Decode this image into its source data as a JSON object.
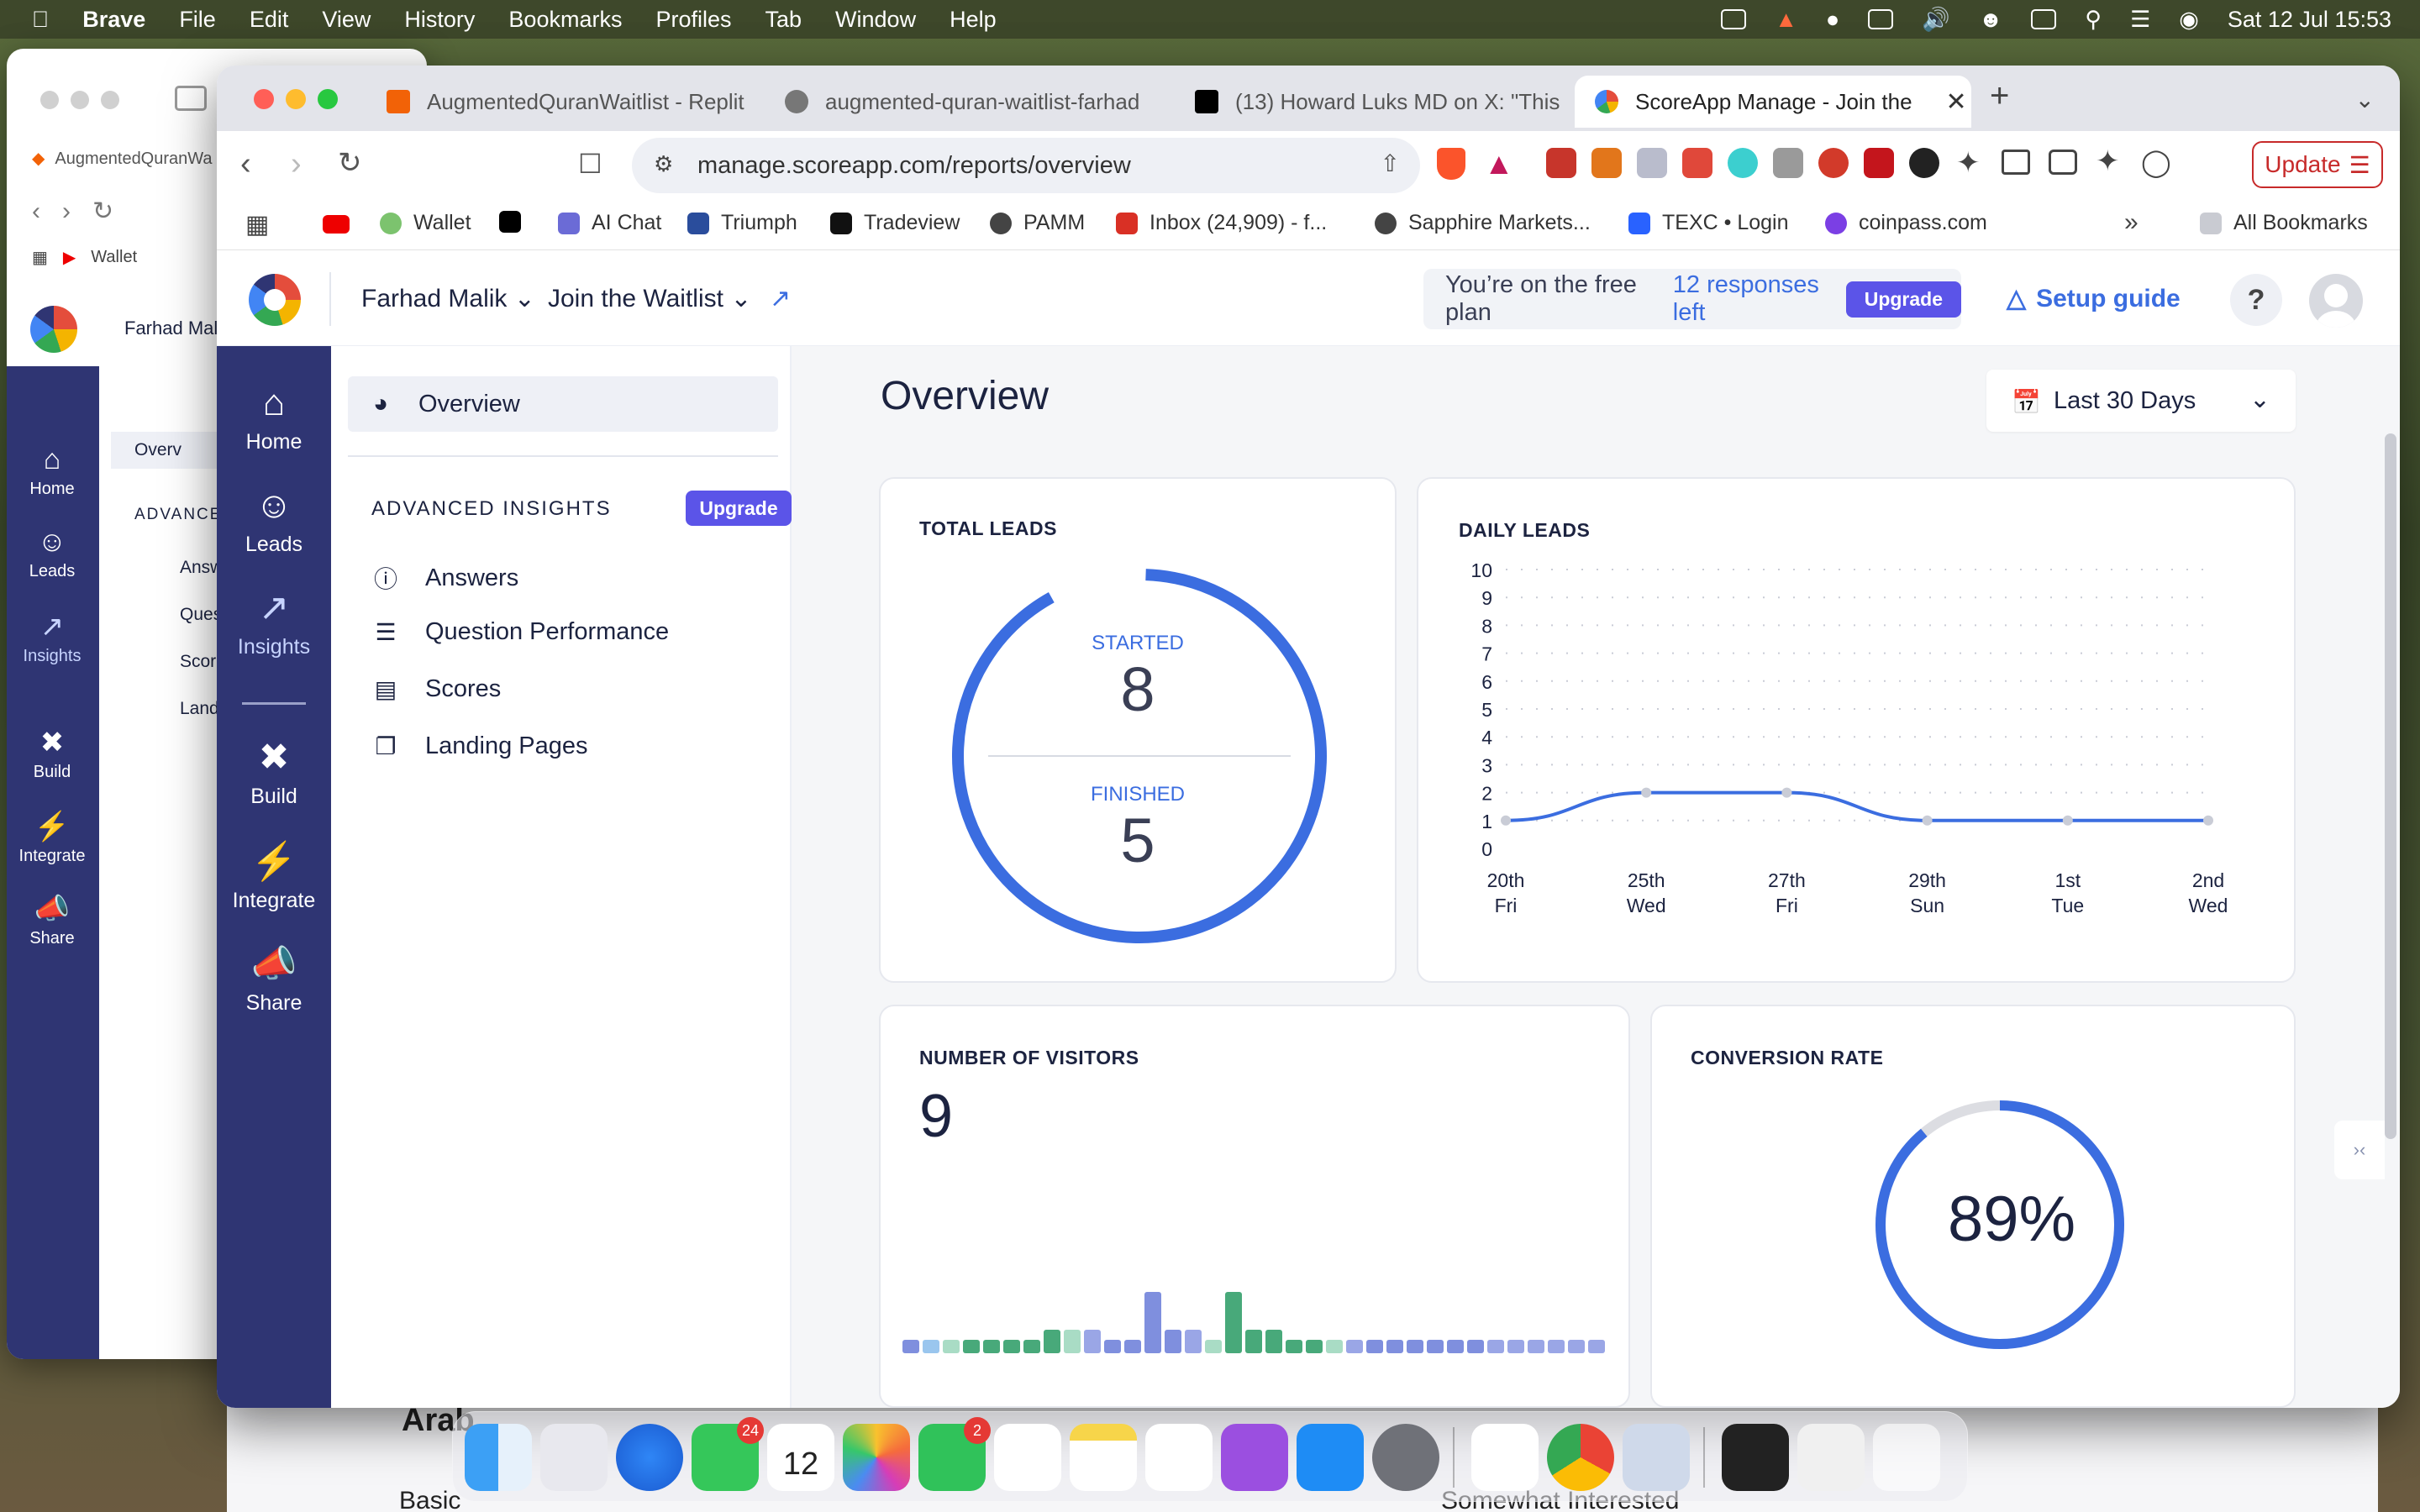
{
  "menubar": {
    "app": "Brave",
    "items": [
      "File",
      "Edit",
      "View",
      "History",
      "Bookmarks",
      "Profiles",
      "Tab",
      "Window",
      "Help"
    ],
    "datetime": "Sat 12 Jul  15:53"
  },
  "back_window": {
    "tab": "AugmentedQuranWa",
    "bookmark": "Wallet",
    "owner": "Farhad Mali",
    "sidebar": [
      "Home",
      "Leads",
      "Insights",
      "Build",
      "Integrate",
      "Share"
    ],
    "subnav": [
      "Overv",
      "ADVANCE",
      "Answ",
      "Ques",
      "Score",
      "Landi"
    ],
    "bottom_title": "Arab",
    "bottom_row_left": "Basic",
    "bottom_row_mid": "Somewhat Interested"
  },
  "tabs": [
    {
      "title": "AugmentedQuranWaitlist - Replit",
      "color": "#f26207"
    },
    {
      "title": "augmented-quran-waitlist-farhad",
      "color": "#666666"
    },
    {
      "title": "(13) Howard Luks MD on X: \"This",
      "color": "#000000"
    },
    {
      "title": "ScoreApp Manage - Join the",
      "color": "#3b6de0"
    }
  ],
  "url": "manage.scoreapp.com/reports/overview",
  "update_label": "Update",
  "bookmarks": [
    {
      "label": "Wallet",
      "color": "#7cc36e"
    },
    {
      "label": "",
      "color": "#000000"
    },
    {
      "label": "AI Chat",
      "color": "#6b6bd6"
    },
    {
      "label": "Triumph",
      "color": "#2a4d9c"
    },
    {
      "label": "Tradeview",
      "color": "#111111"
    },
    {
      "label": "PAMM",
      "color": "#444444"
    },
    {
      "label": "Inbox (24,909) - f...",
      "color": "#d93025"
    },
    {
      "label": "Sapphire Markets...",
      "color": "#444444"
    },
    {
      "label": "TEXC • Login",
      "color": "#2962ff"
    },
    {
      "label": "coinpass.com",
      "color": "#7b3fe4"
    }
  ],
  "all_bookmarks": "All Bookmarks",
  "header": {
    "owner": "Farhad Malik",
    "project": "Join the Waitlist",
    "plan_text": "You’re on the free plan",
    "responses": "12 responses left",
    "upgrade": "Upgrade",
    "setup": "Setup guide",
    "help": "?"
  },
  "sidebar": [
    "Home",
    "Leads",
    "Insights",
    "Build",
    "Integrate",
    "Share"
  ],
  "subnav": {
    "overview": "Overview",
    "heading": "ADVANCED INSIGHTS",
    "upgrade": "Upgrade",
    "items": [
      "Answers",
      "Question Performance",
      "Scores",
      "Landing Pages"
    ]
  },
  "main": {
    "title": "Overview",
    "date_range": "Last 30 Days"
  },
  "total_leads": {
    "title": "TOTAL LEADS",
    "started_label": "STARTED",
    "started": "8",
    "finished_label": "FINISHED",
    "finished": "5"
  },
  "visitors": {
    "title": "NUMBER OF VISITORS",
    "value": "9"
  },
  "conversion": {
    "title": "CONVERSION RATE",
    "value": "89%",
    "fraction": 0.89
  },
  "chart_data": {
    "type": "line",
    "title": "DAILY LEADS",
    "ylim": [
      0,
      10
    ],
    "yticks": [
      "0",
      "1",
      "2",
      "3",
      "4",
      "5",
      "6",
      "7",
      "8",
      "9",
      "10"
    ],
    "x": [
      "20th Fri",
      "25th Wed",
      "27th Fri",
      "29th Sun",
      "1st Tue",
      "2nd Wed"
    ],
    "xticks": [
      [
        "20th",
        "Fri"
      ],
      [
        "25th",
        "Wed"
      ],
      [
        "27th",
        "Fri"
      ],
      [
        "29th",
        "Sun"
      ],
      [
        "1st",
        "Tue"
      ],
      [
        "2nd",
        "Wed"
      ]
    ],
    "values": [
      1,
      2,
      2,
      1,
      1,
      1
    ],
    "grid": true
  },
  "colors": {
    "accent": "#3b6de0",
    "sidebar": "#2f3573",
    "upgrade": "#5b54e8"
  }
}
